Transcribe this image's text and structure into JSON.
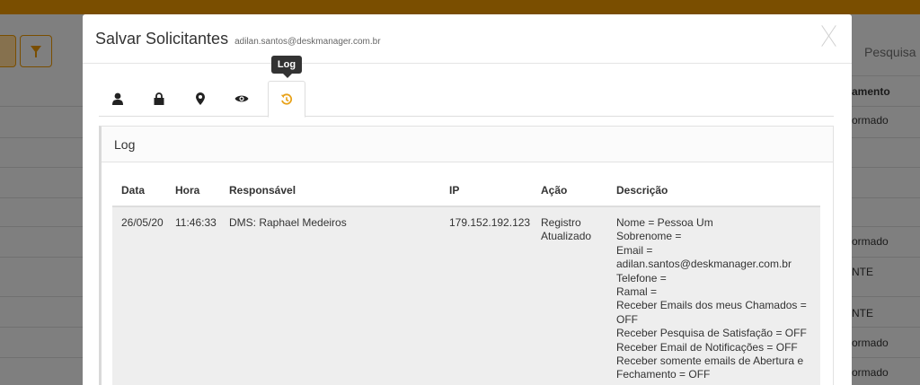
{
  "background": {
    "right_text": {
      "pesquisa": "Pesquisa",
      "col_header": "amento",
      "rows": [
        "ormado",
        "ormado",
        "NTE",
        "NTE",
        "ormado",
        "ormado"
      ]
    }
  },
  "modal": {
    "title": "Salvar Solicitantes",
    "subtitle": "adilan.santos@deskmanager.com.br",
    "tooltip": "Log",
    "tabs": [
      {
        "icon": "user-icon"
      },
      {
        "icon": "lock-icon"
      },
      {
        "icon": "map-marker-icon"
      },
      {
        "icon": "eye-icon"
      },
      {
        "icon": "history-icon",
        "active": true
      }
    ],
    "panel_title": "Log",
    "table": {
      "headers": [
        "Data",
        "Hora",
        "Responsável",
        "IP",
        "Ação",
        "Descrição"
      ],
      "row": {
        "data": "26/05/20",
        "hora": "11:46:33",
        "responsavel": "DMS: Raphael Medeiros",
        "ip": "179.152.192.123",
        "acao": [
          "Registro",
          "Atualizado"
        ],
        "descricao": [
          "Nome = Pessoa Um",
          "Sobrenome =",
          "Email =",
          "adilan.santos@deskmanager.com.br",
          "Telefone =",
          "Ramal =",
          "Receber Emails dos meus Chamados =",
          "OFF",
          "Receber Pesquisa de Satisfação = OFF",
          "Receber Email de Notificações = OFF",
          "Receber somente emails de Abertura e",
          "Fechamento = OFF"
        ]
      }
    }
  },
  "colors": {
    "accent": "#e8a21a",
    "overlay_topbar": "#7a4e00"
  }
}
